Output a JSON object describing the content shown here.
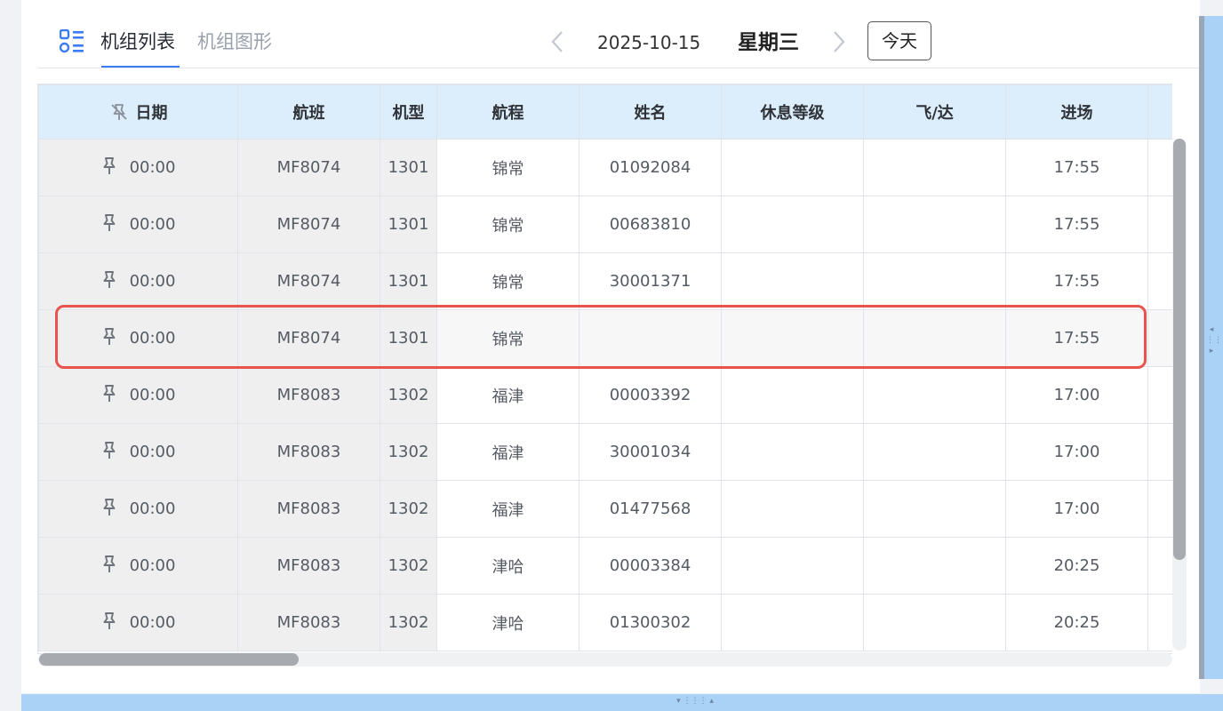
{
  "header": {
    "tabs": [
      {
        "label": "机组列表",
        "active": true
      },
      {
        "label": "机组图形",
        "active": false
      }
    ],
    "date": "2025-10-15",
    "weekday": "星期三",
    "today_label": "今天",
    "accent_color": "#3b7cf2"
  },
  "table": {
    "columns": [
      "日期",
      "航班",
      "机型",
      "航程",
      "姓名",
      "休息等级",
      "飞/达",
      "进场"
    ],
    "rows": [
      {
        "date": "00:00",
        "flight": "MF8074",
        "aircraft": "1301",
        "route": "锦常",
        "name": "01092084",
        "rest_level": "",
        "fly_arrive": "",
        "entry": "17:55"
      },
      {
        "date": "00:00",
        "flight": "MF8074",
        "aircraft": "1301",
        "route": "锦常",
        "name": "00683810",
        "rest_level": "",
        "fly_arrive": "",
        "entry": "17:55"
      },
      {
        "date": "00:00",
        "flight": "MF8074",
        "aircraft": "1301",
        "route": "锦常",
        "name": "30001371",
        "rest_level": "",
        "fly_arrive": "",
        "entry": "17:55"
      },
      {
        "date": "00:00",
        "flight": "MF8074",
        "aircraft": "1301",
        "route": "锦常",
        "name": "",
        "rest_level": "",
        "fly_arrive": "",
        "entry": "17:55"
      },
      {
        "date": "00:00",
        "flight": "MF8083",
        "aircraft": "1302",
        "route": "福津",
        "name": "00003392",
        "rest_level": "",
        "fly_arrive": "",
        "entry": "17:00"
      },
      {
        "date": "00:00",
        "flight": "MF8083",
        "aircraft": "1302",
        "route": "福津",
        "name": "30001034",
        "rest_level": "",
        "fly_arrive": "",
        "entry": "17:00"
      },
      {
        "date": "00:00",
        "flight": "MF8083",
        "aircraft": "1302",
        "route": "福津",
        "name": "01477568",
        "rest_level": "",
        "fly_arrive": "",
        "entry": "17:00"
      },
      {
        "date": "00:00",
        "flight": "MF8083",
        "aircraft": "1302",
        "route": "津哈",
        "name": "00003384",
        "rest_level": "",
        "fly_arrive": "",
        "entry": "20:25"
      },
      {
        "date": "00:00",
        "flight": "MF8083",
        "aircraft": "1302",
        "route": "津哈",
        "name": "01300302",
        "rest_level": "",
        "fly_arrive": "",
        "entry": "20:25"
      }
    ],
    "header_bg": "#dceefc",
    "highlight_outline_color": "#e8534c"
  },
  "icons": {
    "view": "list-grid-icon",
    "unpin": "unpin-icon",
    "pin": "pin-icon",
    "prev": "chevron-left-icon",
    "next": "chevron-right-icon"
  }
}
